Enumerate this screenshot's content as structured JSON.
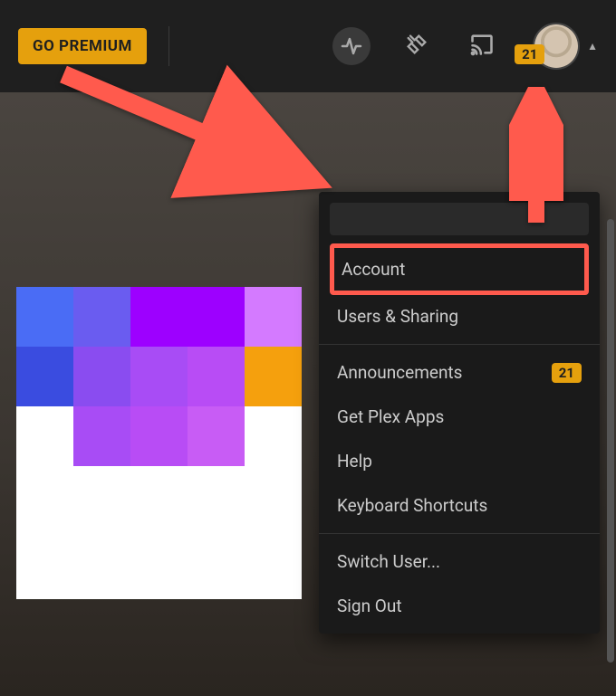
{
  "topbar": {
    "premium_label": "GO PREMIUM",
    "notification_count": "21"
  },
  "dropdown": {
    "group1": [
      {
        "label": "Account",
        "highlighted": true
      },
      {
        "label": "Users & Sharing"
      }
    ],
    "group2": [
      {
        "label": "Announcements",
        "badge": "21"
      },
      {
        "label": "Get Plex Apps"
      },
      {
        "label": "Help"
      },
      {
        "label": "Keyboard Shortcuts"
      }
    ],
    "group3": [
      {
        "label": "Switch User..."
      },
      {
        "label": "Sign Out"
      }
    ]
  },
  "colors": {
    "accent": "#e5a00d",
    "highlight": "#ff5a4d"
  },
  "pix": {
    "r1": [
      "#4a6cf5",
      "#6a5cf0",
      "#9d00ff",
      "#9d00ff",
      "#d47aff"
    ],
    "r2": [
      "#3a4ce0",
      "#8a4cf0",
      "#a84cf5",
      "#b84cf5",
      "#f5a00d"
    ],
    "r3": [
      "#ffffff",
      "#a84cf5",
      "#b84cf5",
      "#c85cf5",
      "#ffffff"
    ],
    "r4": [
      "#ffffff",
      "#ffffff",
      "#ffffff",
      "#ffffff",
      "#ffffff"
    ],
    "r5": [
      "#ffffff",
      "#ffffff",
      "#ffffff",
      "#ffffff",
      "#ffffff"
    ]
  }
}
